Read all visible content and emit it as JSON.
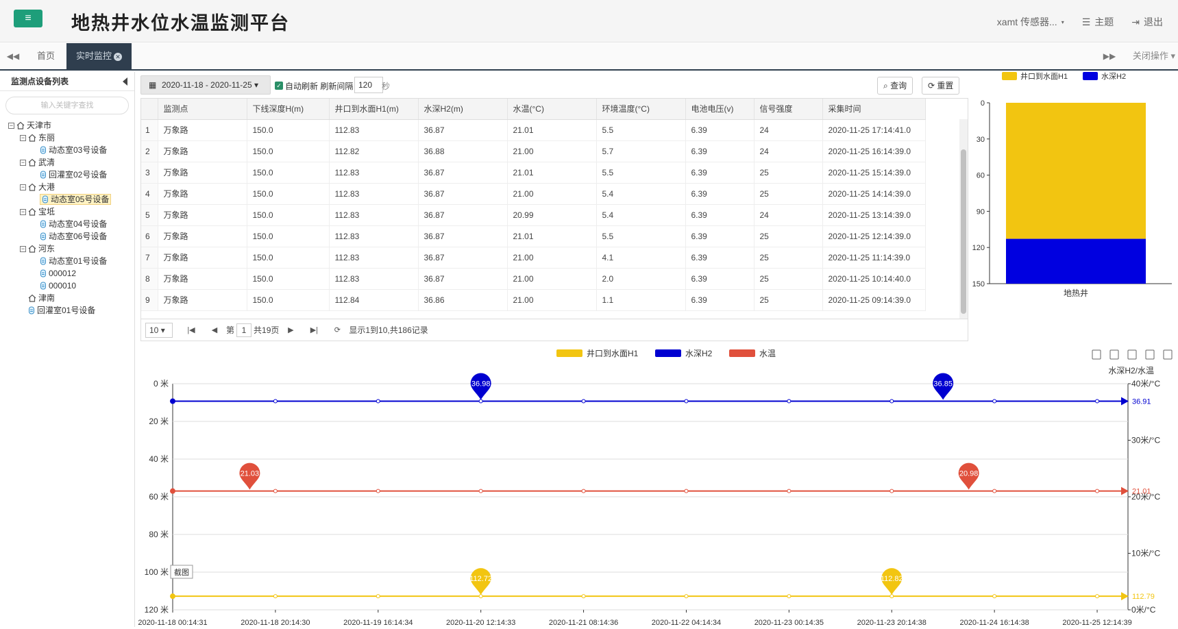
{
  "header": {
    "title": "地热井水位水温监测平台",
    "user": "xamt 传感器...",
    "theme": "主题",
    "logout": "退出"
  },
  "tabs": {
    "home": "首页",
    "active": "实时监控",
    "close_ops": "关闭操作"
  },
  "sidebar": {
    "title": "监测点设备列表",
    "search_placeholder": "输入关键字查找",
    "tree": [
      "天津市",
      "东丽",
      "动态室03号设备",
      "武清",
      "回灌室02号设备",
      "大港",
      "动态室05号设备",
      "宝坻",
      "动态室04号设备",
      "动态室06号设备",
      "河东",
      "动态室01号设备",
      "000012",
      "000010",
      "津南",
      "回灌室01号设备"
    ]
  },
  "filter": {
    "date_range": "2020-11-18 - 2020-11-25",
    "auto_refresh": "自动刷新",
    "interval_label": "刷新间隔",
    "interval_value": "120",
    "interval_unit": "秒",
    "query": "查询",
    "reset": "重置"
  },
  "table": {
    "columns": [
      "监测点",
      "下线深度H(m)",
      "井口到水面H1(m)",
      "水深H2(m)",
      "水温(°C)",
      "环境温度(°C)",
      "电池电压(v)",
      "信号强度",
      "采集时间"
    ],
    "rows": [
      [
        "1",
        "万象路",
        "150.0",
        "112.83",
        "36.87",
        "21.01",
        "5.5",
        "6.39",
        "24",
        "2020-11-25 17:14:41.0"
      ],
      [
        "2",
        "万象路",
        "150.0",
        "112.82",
        "36.88",
        "21.00",
        "5.7",
        "6.39",
        "24",
        "2020-11-25 16:14:39.0"
      ],
      [
        "3",
        "万象路",
        "150.0",
        "112.83",
        "36.87",
        "21.01",
        "5.5",
        "6.39",
        "25",
        "2020-11-25 15:14:39.0"
      ],
      [
        "4",
        "万象路",
        "150.0",
        "112.83",
        "36.87",
        "21.00",
        "5.4",
        "6.39",
        "25",
        "2020-11-25 14:14:39.0"
      ],
      [
        "5",
        "万象路",
        "150.0",
        "112.83",
        "36.87",
        "20.99",
        "5.4",
        "6.39",
        "24",
        "2020-11-25 13:14:39.0"
      ],
      [
        "6",
        "万象路",
        "150.0",
        "112.83",
        "36.87",
        "21.01",
        "5.5",
        "6.39",
        "25",
        "2020-11-25 12:14:39.0"
      ],
      [
        "7",
        "万象路",
        "150.0",
        "112.83",
        "36.87",
        "21.00",
        "4.1",
        "6.39",
        "25",
        "2020-11-25 11:14:39.0"
      ],
      [
        "8",
        "万象路",
        "150.0",
        "112.83",
        "36.87",
        "21.00",
        "2.0",
        "6.39",
        "25",
        "2020-11-25 10:14:40.0"
      ],
      [
        "9",
        "万象路",
        "150.0",
        "112.84",
        "36.86",
        "21.00",
        "1.1",
        "6.39",
        "25",
        "2020-11-25 09:14:39.0"
      ]
    ]
  },
  "pager": {
    "page_size": "10",
    "page_prefix": "第",
    "page": "1",
    "total_pages": "共19页",
    "summary": "显示1到10,共186记录"
  },
  "chart_data": [
    {
      "type": "bar",
      "stacked": true,
      "categories": [
        "地热井"
      ],
      "series": [
        {
          "name": "井口到水面H1",
          "values": [
            112.83
          ],
          "color": "#f2c511"
        },
        {
          "name": "水深H2",
          "values": [
            37.17
          ],
          "color": "#0000e0"
        }
      ],
      "ylim": [
        0,
        150
      ],
      "y_inverted": true,
      "yticks": [
        "0",
        "30",
        "60",
        "90",
        "120",
        "150"
      ],
      "legend": "top"
    },
    {
      "type": "line",
      "legend": "top",
      "x": [
        "2020-11-18 00:14:31",
        "2020-11-18 20:14:30",
        "2020-11-19 16:14:34",
        "2020-11-20 12:14:33",
        "2020-11-21 08:14:36",
        "2020-11-22 04:14:34",
        "2020-11-23 00:14:35",
        "2020-11-23 20:14:38",
        "2020-11-24 16:14:38",
        "2020-11-25 12:14:39"
      ],
      "series": [
        {
          "name": "井口到水面H1",
          "axis": "left",
          "color": "#f2c511",
          "values": [
            112.79,
            112.79,
            112.79,
            112.79,
            112.79,
            112.79,
            112.79,
            112.79,
            112.79,
            112.79
          ],
          "markers": [
            {
              "label": "112.72",
              "x_index": 3
            },
            {
              "label": "112.82",
              "x_index": 7
            }
          ],
          "end_label": "112.79"
        },
        {
          "name": "水深H2",
          "axis": "right",
          "color": "#0000d0",
          "values": [
            36.91,
            36.91,
            36.91,
            36.91,
            36.91,
            36.91,
            36.91,
            36.91,
            36.91,
            36.91
          ],
          "markers": [
            {
              "label": "36.98",
              "x_index": 3
            },
            {
              "label": "36.85",
              "x_index": 7.5
            }
          ],
          "end_label": "36.91"
        },
        {
          "name": "水温",
          "axis": "right",
          "color": "#e0503c",
          "values": [
            21.01,
            21.01,
            21.01,
            21.01,
            21.01,
            21.01,
            21.01,
            21.01,
            21.01,
            21.01
          ],
          "markers": [
            {
              "label": "21.03",
              "x_index": 0.75
            },
            {
              "label": "20.98",
              "x_index": 7.75
            }
          ],
          "end_label": "21.01"
        }
      ],
      "left_axis": {
        "ylim": [
          0,
          120
        ],
        "inverted": true,
        "ticks": [
          "0 米",
          "20 米",
          "40 米",
          "60 米",
          "80 米",
          "100 米",
          "120 米"
        ]
      },
      "right_axis": {
        "name": "水深H2/水温",
        "ylim": [
          0,
          40
        ],
        "ticks": [
          "40米/°C",
          "30米/°C",
          "20米/°C",
          "10米/°C",
          "0米/°C"
        ]
      },
      "tooltip": "截图"
    }
  ]
}
